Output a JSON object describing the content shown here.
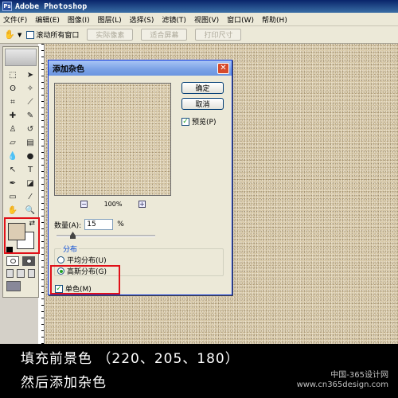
{
  "window": {
    "app_title": "Adobe Photoshop",
    "logo_letter": "Ps"
  },
  "menubar": {
    "items": [
      "文件(F)",
      "编辑(E)",
      "图像(I)",
      "图层(L)",
      "选择(S)",
      "滤镜(T)",
      "视图(V)",
      "窗口(W)",
      "帮助(H)"
    ]
  },
  "options": {
    "tool_icon": "hand-icon",
    "resize_all_windows_label": "滚动所有窗口",
    "actual_pixels_label": "实际像素",
    "fit_screen_label": "适合屏幕",
    "print_size_label": "打印尺寸"
  },
  "dialog": {
    "title": "添加杂色",
    "ok_label": "确定",
    "cancel_label": "取消",
    "preview_label": "预览(P)",
    "preview_checked": true,
    "zoom_out": "−",
    "zoom_in": "+",
    "zoom_level": "100%",
    "amount_label": "数量(A):",
    "amount_value": "15",
    "amount_unit": "%",
    "distribution_legend": "分布",
    "uniform_label": "平均分布(U)",
    "gaussian_label": "高斯分布(G)",
    "distribution_selected": "gaussian",
    "monochromatic_label": "单色(M)",
    "monochromatic_checked": true
  },
  "colors": {
    "foreground": "#dccdb4",
    "background": "#ffffff",
    "highlight": "#e01018"
  },
  "caption": {
    "line1": "填充前景色 （220、205、180）",
    "line2": "然后添加杂色"
  },
  "watermark": {
    "line1": "中国-365设计网",
    "line2": "www.cn365design.com"
  }
}
